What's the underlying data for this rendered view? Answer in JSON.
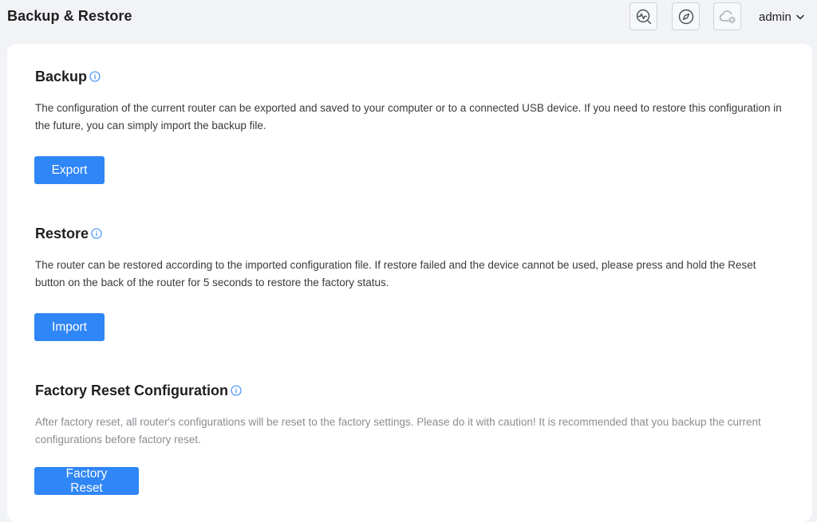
{
  "header": {
    "title": "Backup & Restore",
    "icons": [
      "diagnostics-icon",
      "compass-icon",
      "cloud-disconnected-icon"
    ],
    "user": "admin"
  },
  "sections": {
    "backup": {
      "title": "Backup",
      "description": "The configuration of the current router can be exported and saved to your computer or to a connected USB device. If you need to restore this configuration in the future, you can simply import the backup file.",
      "button": "Export"
    },
    "restore": {
      "title": "Restore",
      "description": "The router can be restored according to the imported configuration file. If restore failed and the device cannot be used, please press and hold the Reset button on the back of the router for 5 seconds to restore the factory status.",
      "button": "Import"
    },
    "factory": {
      "title": "Factory Reset Configuration",
      "description": "After factory reset, all router's configurations will be reset to the factory settings. Please do it with caution! It is recommended that you backup the current configurations before factory reset.",
      "button": "Factory Reset"
    }
  },
  "colors": {
    "accent": "#2f86f6",
    "background": "#f2f3f6",
    "card": "#ffffff"
  }
}
